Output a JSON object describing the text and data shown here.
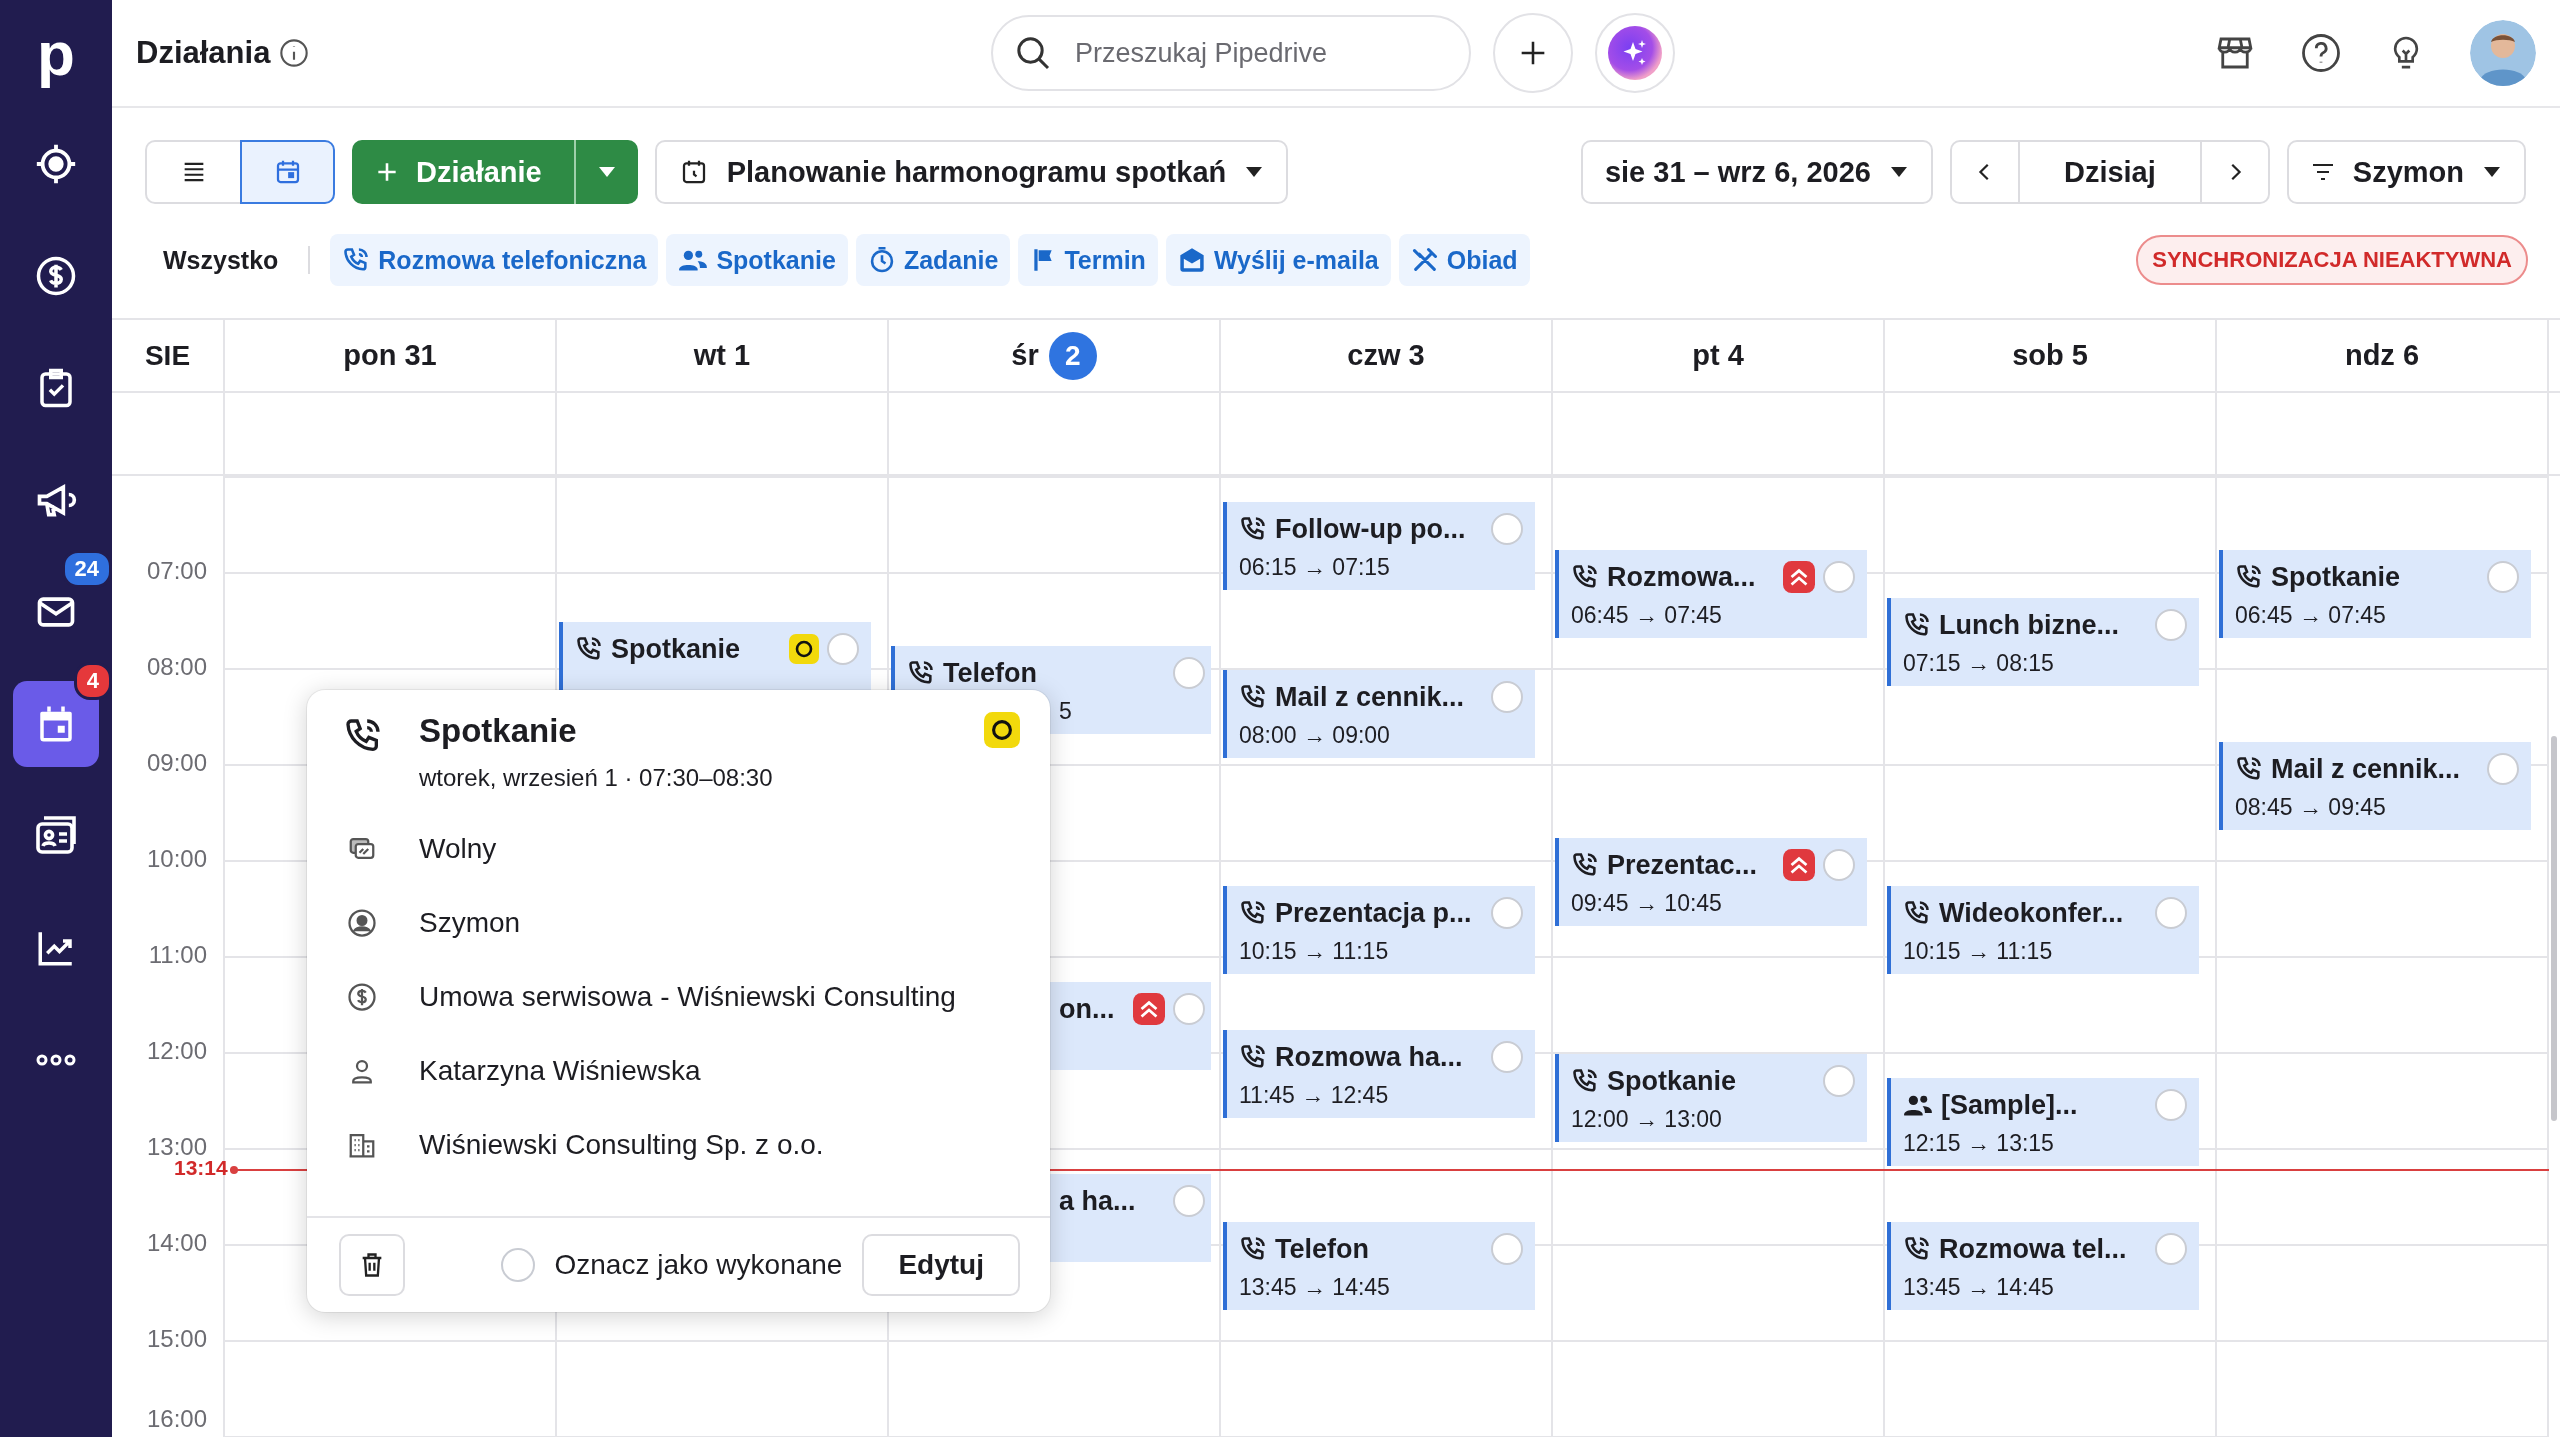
{
  "sidebar": {
    "logo": "p",
    "items": [
      {
        "kind": "target",
        "selected": false
      },
      {
        "kind": "deals",
        "selected": false
      },
      {
        "kind": "tasks",
        "selected": false
      },
      {
        "kind": "campaigns",
        "selected": false
      },
      {
        "kind": "mail",
        "selected": false,
        "badge": "24",
        "color": "#2f6fde"
      },
      {
        "kind": "calendar",
        "selected": true,
        "badge": "4",
        "color": "#e5383b"
      },
      {
        "kind": "contacts",
        "selected": false
      },
      {
        "kind": "insights",
        "selected": false
      },
      {
        "kind": "more",
        "selected": false
      }
    ]
  },
  "topbar": {
    "title": "Działania",
    "search": {
      "placeholder": "Przeszukaj Pipedrive"
    }
  },
  "toolbar": {
    "views": [
      {
        "kind": "list",
        "selected": false
      },
      {
        "kind": "calendar",
        "selected": true
      }
    ],
    "add_button": "Działanie",
    "filter": "Planowanie harmonogramu spotkań",
    "date_range": "sie 31 – wrz 6, 2026",
    "today": "Dzisiaj",
    "user_filter": "Szymon"
  },
  "filters": {
    "all": "Wszystko",
    "types": [
      {
        "kind": "call",
        "label": "Rozmowa telefoniczna"
      },
      {
        "kind": "meeting",
        "label": "Spotkanie"
      },
      {
        "kind": "task",
        "label": "Zadanie"
      },
      {
        "kind": "deadline",
        "label": "Termin"
      },
      {
        "kind": "email",
        "label": "Wyślij e-maila"
      },
      {
        "kind": "lunch",
        "label": "Obiad"
      }
    ],
    "sync_status": "SYNCHRONIZACJA NIEAKTYWNA"
  },
  "calendar": {
    "month": "SIE",
    "hours": [
      "07:00",
      "08:00",
      "09:00",
      "10:00",
      "11:00",
      "12:00",
      "13:00",
      "14:00",
      "15:00",
      "16:00"
    ],
    "now": "13:14",
    "days": [
      {
        "label": "pon",
        "number": "31",
        "today": false
      },
      {
        "label": "wt",
        "number": "1",
        "today": false,
        "events": [
          {
            "kind": "call",
            "title": "Spotkanie",
            "priority": false,
            "marked": true,
            "done": false
          }
        ]
      },
      {
        "label": "śr",
        "number": "2",
        "today": true,
        "events": [
          {
            "kind": "call",
            "title": "Telefon",
            "time": "5",
            "priority": false,
            "marked": false,
            "done": false
          },
          {
            "title": "on...",
            "priority": true,
            "marked": false,
            "done": false
          },
          {
            "title": "a ha...",
            "priority": false,
            "marked": false,
            "done": false
          }
        ]
      },
      {
        "label": "czw",
        "number": "3",
        "today": false,
        "events": [
          {
            "kind": "call",
            "title": "Follow-up po...",
            "time": "06:15 → 07:15",
            "priority": false,
            "marked": false,
            "done": false
          },
          {
            "kind": "call",
            "title": "Mail z cennik...",
            "time": "08:00 → 09:00",
            "priority": false,
            "marked": false,
            "done": false
          },
          {
            "kind": "call",
            "title": "Prezentacja p...",
            "time": "10:15 → 11:15",
            "priority": false,
            "marked": false,
            "done": false
          },
          {
            "kind": "call",
            "title": "Rozmowa ha...",
            "time": "11:45 → 12:45",
            "priority": false,
            "marked": false,
            "done": false
          },
          {
            "kind": "call",
            "title": "Telefon",
            "time": "13:45 → 14:45",
            "priority": false,
            "marked": false,
            "done": false
          }
        ]
      },
      {
        "label": "pt",
        "number": "4",
        "today": false,
        "events": [
          {
            "kind": "call",
            "title": "Rozmowa...",
            "time": "06:45 → 07:45",
            "priority": true,
            "marked": false,
            "done": false
          },
          {
            "kind": "call",
            "title": "Prezentac...",
            "time": "09:45 → 10:45",
            "priority": true,
            "marked": false,
            "done": false
          },
          {
            "kind": "call",
            "title": "Spotkanie",
            "time": "12:00 → 13:00",
            "priority": false,
            "marked": false,
            "done": false
          }
        ]
      },
      {
        "label": "sob",
        "number": "5",
        "today": false,
        "events": [
          {
            "kind": "call",
            "title": "Lunch bizne...",
            "time": "07:15 → 08:15",
            "priority": false,
            "marked": false,
            "done": false
          },
          {
            "kind": "call",
            "title": "Wideokonfer...",
            "time": "10:15 → 11:15",
            "priority": false,
            "marked": false,
            "done": false
          },
          {
            "kind": "meeting",
            "title": "[Sample]...",
            "time": "12:15 → 13:15",
            "priority": false,
            "marked": false,
            "done": false
          },
          {
            "kind": "call",
            "title": "Rozmowa tel...",
            "time": "13:45 → 14:45",
            "priority": false,
            "marked": false,
            "done": false
          }
        ]
      },
      {
        "label": "ndz",
        "number": "6",
        "today": false,
        "events": [
          {
            "kind": "call",
            "title": "Spotkanie",
            "time": "06:45 → 07:45",
            "priority": false,
            "marked": false,
            "done": false
          },
          {
            "kind": "call",
            "title": "Mail z cennik...",
            "time": "08:45 → 09:45",
            "priority": false,
            "marked": false,
            "done": false
          }
        ]
      }
    ]
  },
  "popup": {
    "title": "Spotkanie",
    "subtitle": "wtorek, wrzesień 1 · 07:30–08:30",
    "marked": true,
    "rows": [
      {
        "kind": "availability",
        "text": "Wolny"
      },
      {
        "kind": "owner",
        "text": "Szymon"
      },
      {
        "kind": "deal",
        "text": "Umowa serwisowa - Wiśniewski Consulting"
      },
      {
        "kind": "person",
        "text": "Katarzyna Wiśniewska"
      },
      {
        "kind": "organization",
        "text": "Wiśniewski Consulting Sp. z o.o."
      }
    ],
    "done": false,
    "done_label": "Oznacz jako wykonane",
    "edit": "Edytuj"
  }
}
